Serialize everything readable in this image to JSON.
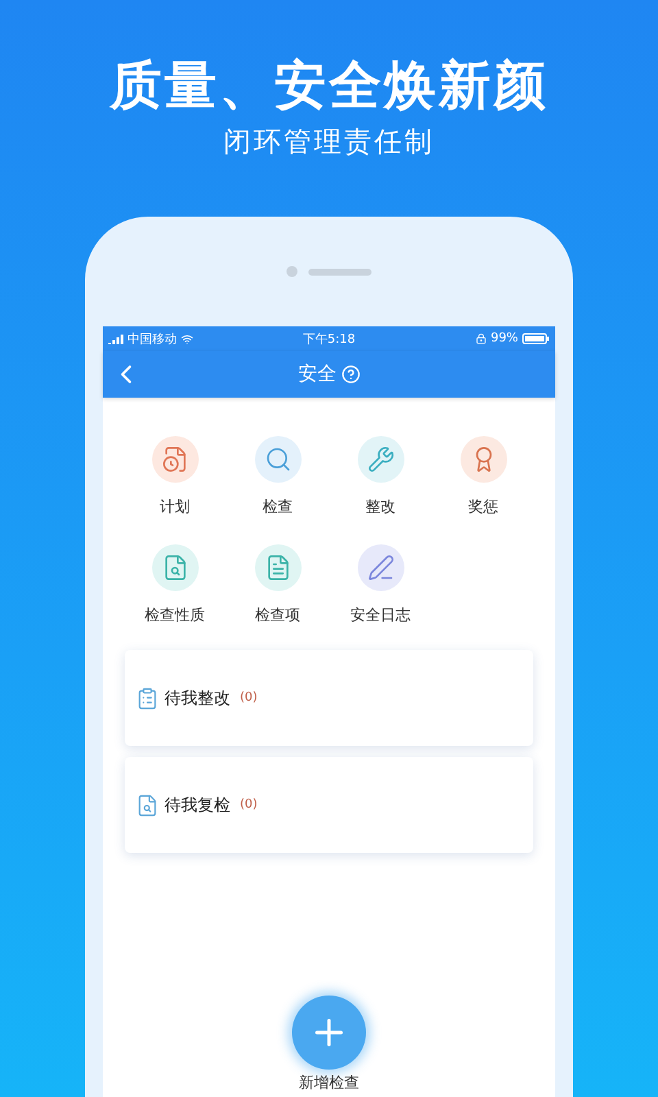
{
  "headline": "质量、安全焕新颜",
  "subtitle": "闭环管理责任制",
  "status_bar": {
    "carrier": "中国移动",
    "time": "下午5:18",
    "battery": "99%"
  },
  "nav": {
    "title": "安全"
  },
  "modules": [
    {
      "label": "计划",
      "kind": "plan",
      "color": "#e07555"
    },
    {
      "label": "检查",
      "kind": "inspect",
      "color": "#4a9fd8"
    },
    {
      "label": "整改",
      "kind": "fix",
      "color": "#3aaec0"
    },
    {
      "label": "奖惩",
      "kind": "award",
      "color": "#d9734f"
    },
    {
      "label": "检查性质",
      "kind": "nature",
      "color": "#3bb3a8"
    },
    {
      "label": "检查项",
      "kind": "item",
      "color": "#3bb3a8"
    },
    {
      "label": "安全日志",
      "kind": "log",
      "color": "#7b86dc"
    }
  ],
  "tasks": [
    {
      "label": "待我整改",
      "count": "(0)",
      "kind": "rectify"
    },
    {
      "label": "待我复检",
      "count": "(0)",
      "kind": "recheck"
    }
  ],
  "fab": {
    "label": "新增检查"
  }
}
